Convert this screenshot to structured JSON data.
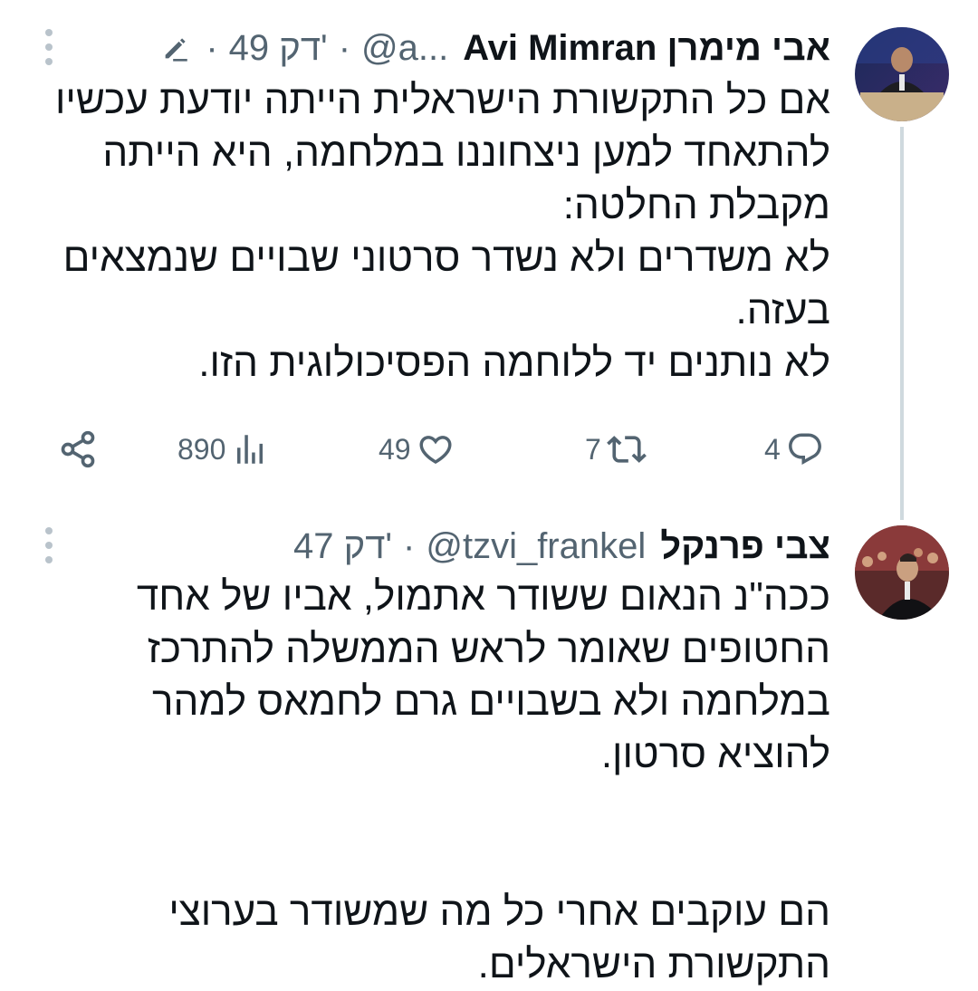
{
  "tweets": [
    {
      "name": "Avi Mimran אבי מימרן",
      "handle": "@a...",
      "time": "49 דק'",
      "edited": true,
      "text": "אם כל התקשורת הישראלית הייתה יודעת עכשיו\nלהתאחד למען ניצחוננו במלחמה, היא הייתה\nמקבלת החלטה:\nלא משדרים ולא נשדר סרטוני שבויים שנמצאים\nבעזה.\nלא נותנים יד ללוחמה הפסיכולוגית הזו.",
      "stats": {
        "replies": "4",
        "retweets": "7",
        "likes": "49",
        "views": "890"
      }
    },
    {
      "name": "צבי פרנקל",
      "handle": "@tzvi_frankel",
      "time": "47 דק'",
      "text": "ככה\"נ הנאום ששודר אתמול, אביו של אחד\nהחטופים שאומר לראש הממשלה להתרכז\nבמלחמה ולא בשבויים גרם לחמאס למהר\nלהוציא סרטון.\n\n\nהם עוקבים אחרי כל מה שמשודר בערוצי\nהתקשורת הישראלים."
    }
  ],
  "colors": {
    "text": "#0f1419",
    "secondary": "#536471",
    "thread_line": "#cfd9de"
  },
  "icons": {
    "reply": "reply-icon",
    "retweet": "retweet-icon",
    "like": "heart-icon",
    "views": "views-icon",
    "share": "share-icon",
    "more": "more-icon",
    "edit": "edit-icon"
  }
}
